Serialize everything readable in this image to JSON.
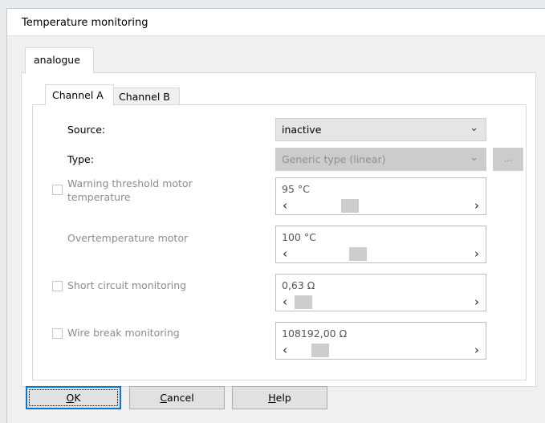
{
  "window": {
    "title": "Temperature monitoring"
  },
  "tabs": {
    "outer": "analogue",
    "channel_a": "Channel A",
    "channel_b": "Channel B"
  },
  "form": {
    "source": {
      "label": "Source:",
      "value": "inactive"
    },
    "type": {
      "label": "Type:",
      "value": "Generic type (linear)",
      "button": "..."
    },
    "warning": {
      "label": "Warning threshold motor temperature",
      "value": "95 °C",
      "position": 0.3,
      "checked": false
    },
    "overtemp": {
      "label": "Overtemperature motor",
      "value": "100 °C",
      "position": 0.35
    },
    "short_circuit": {
      "label": "Short circuit monitoring",
      "value": "0,63 Ω",
      "position": 0.0,
      "checked": false
    },
    "wire_break": {
      "label": "Wire break monitoring",
      "value": "108192,00 Ω",
      "position": 0.11,
      "checked": false
    }
  },
  "buttons": {
    "ok": {
      "pre": "",
      "ul": "O",
      "post": "K"
    },
    "cancel": {
      "pre": "",
      "ul": "C",
      "post": "ancel"
    },
    "help": {
      "pre": "",
      "ul": "H",
      "post": "elp"
    }
  },
  "icons": {
    "chevron": "chevron-down-icon",
    "scroll_left": "scroll-left-icon",
    "scroll_right": "scroll-right-icon"
  },
  "colors": {
    "accent": "#0078d7"
  }
}
